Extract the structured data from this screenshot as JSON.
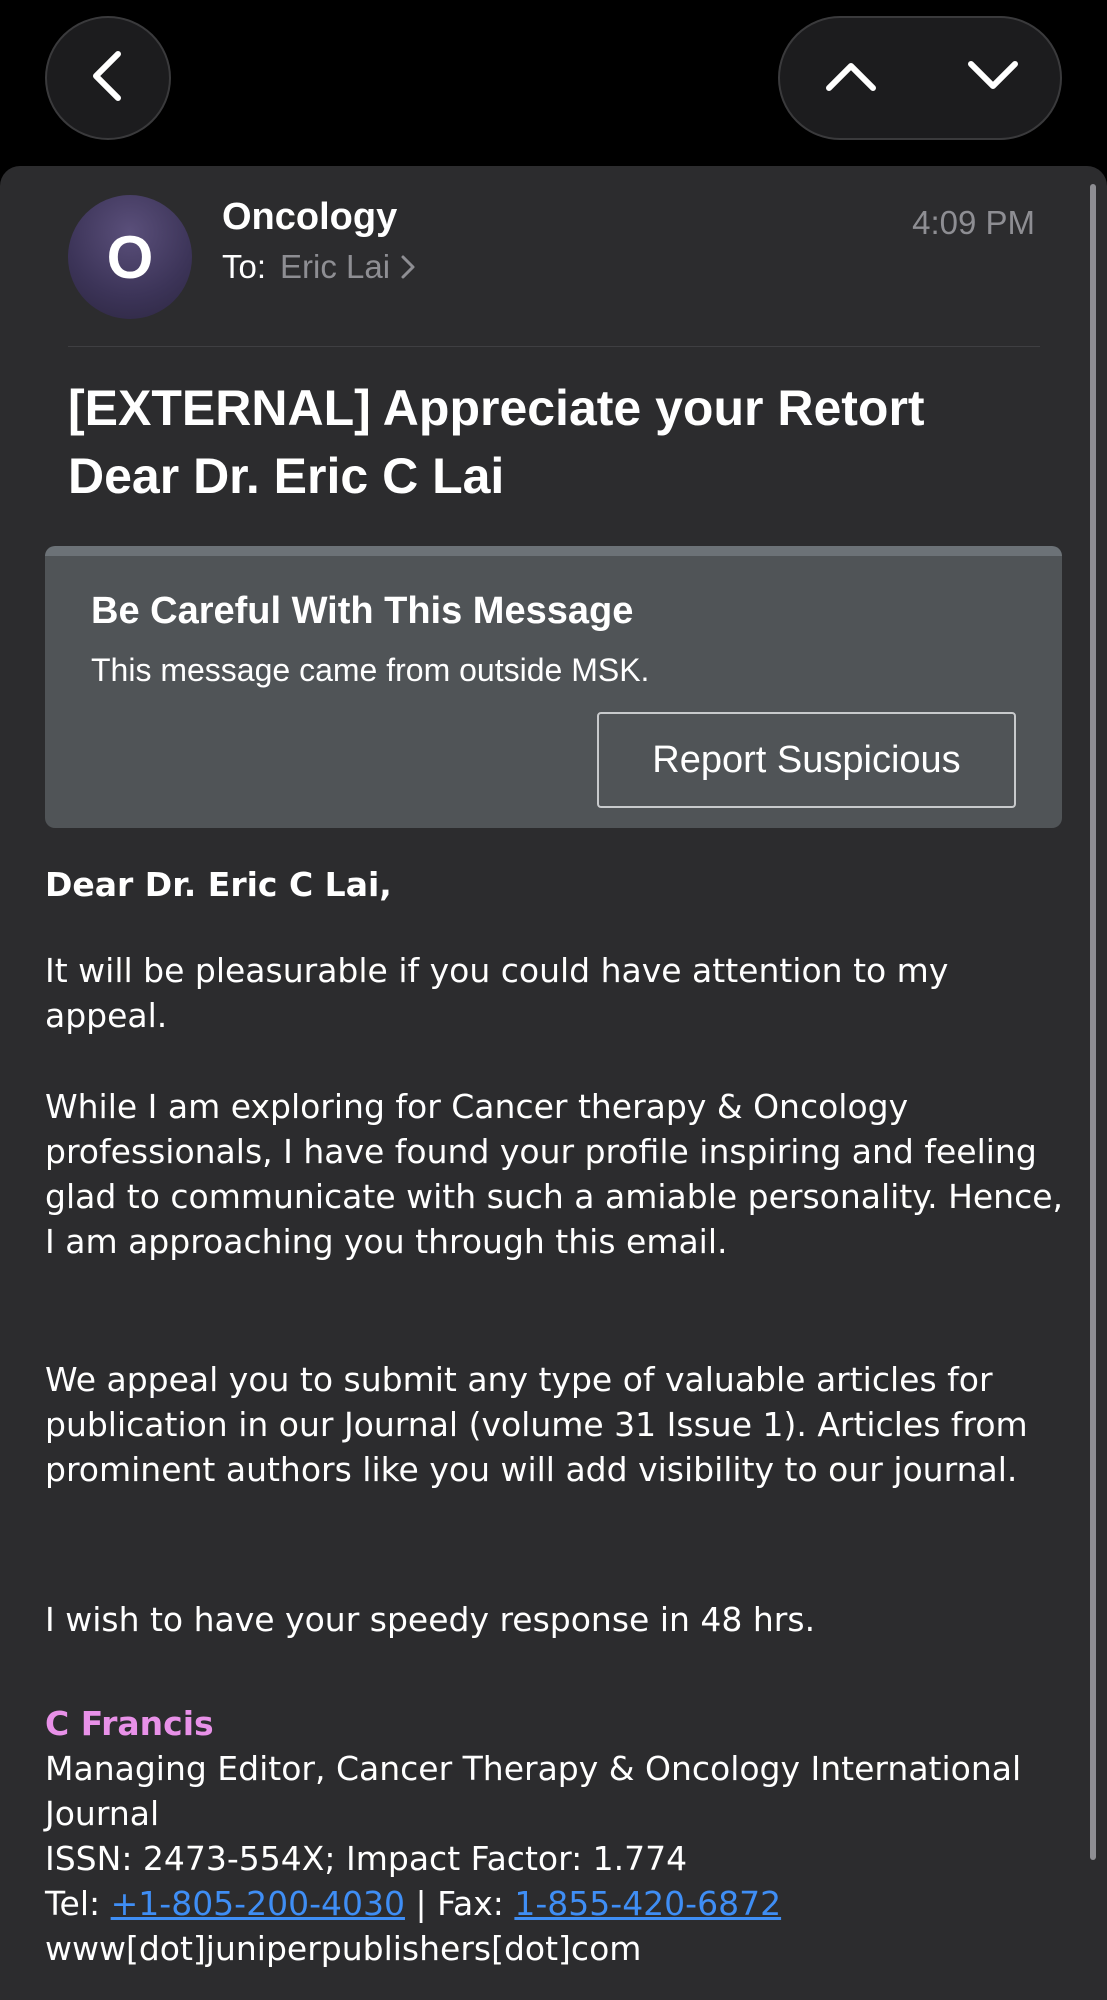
{
  "nav": {
    "back_icon": "chevron-left-icon",
    "prev_icon": "chevron-up-icon",
    "next_icon": "chevron-down-icon"
  },
  "header": {
    "avatar_letter": "O",
    "sender": "Oncology",
    "to_label": "To:",
    "recipient": "Eric Lai",
    "time": "4:09 PM"
  },
  "subject": "[EXTERNAL] Appreciate your Retort Dear Dr. Eric C Lai",
  "warning": {
    "title": "Be Careful With This Message",
    "text": "This message came from outside MSK.",
    "button_label": "Report Suspicious"
  },
  "body": {
    "greeting": "Dear Dr. Eric C Lai,",
    "paragraph1": "It will be pleasurable if you could have attention to my appeal.",
    "paragraph2": "While I am exploring for Cancer therapy & Oncology professionals, I have found your profile inspiring and feeling glad to communicate with such a amiable personality. Hence, I am approaching you through this email.",
    "paragraph3": "We appeal you to submit any type of valuable articles for publication in our Journal (volume 31 Issue 1). Articles from prominent authors like you will add visibility to our journal.",
    "paragraph4": "I wish to have your speedy response in 48 hrs."
  },
  "signature": {
    "name": "C Francis",
    "title": "Managing Editor, Cancer Therapy & Oncology International Journal",
    "issn": "ISSN: 2473-554X; Impact Factor: 1.774",
    "tel_label": "Tel: ",
    "tel": "+1-805-200-4030",
    "fax_label": " | Fax: ",
    "fax": "1-855-420-6872",
    "website": "www[dot]juniperpublishers[dot]com"
  },
  "colors": {
    "background": "#000000",
    "sheet": "#2c2c2e",
    "warning_bg": "#505457",
    "link": "#3f8ef5",
    "signature_name": "#e891e8"
  }
}
